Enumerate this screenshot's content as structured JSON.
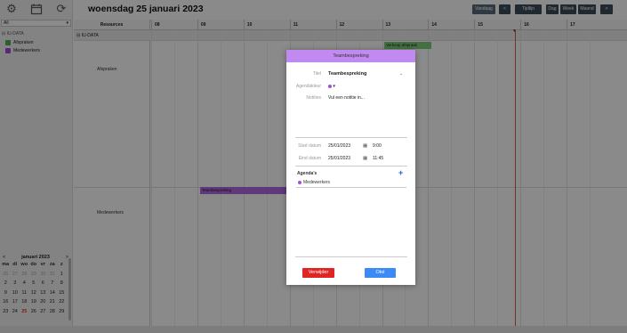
{
  "sidebar": {
    "scope_select": "All",
    "group_label": "IU-DATA",
    "calendars": [
      {
        "label": "Afspraken",
        "color": "#4caf50"
      },
      {
        "label": "Medewerkers",
        "color": "#a64dd6"
      }
    ],
    "mini_calendar": {
      "title": "januari 2023",
      "prev": "<",
      "next": ">",
      "weekdays": [
        "ma",
        "di",
        "wo",
        "do",
        "vr",
        "za",
        "z"
      ],
      "weeks": [
        [
          "26",
          "27",
          "28",
          "29",
          "30",
          "31",
          "1"
        ],
        [
          "2",
          "3",
          "4",
          "5",
          "6",
          "7",
          "8"
        ],
        [
          "9",
          "10",
          "11",
          "12",
          "13",
          "14",
          "15"
        ],
        [
          "16",
          "17",
          "18",
          "19",
          "20",
          "21",
          "22"
        ],
        [
          "23",
          "24",
          "25",
          "26",
          "27",
          "28",
          "29"
        ]
      ]
    }
  },
  "toolbar": {
    "date_title": "woensdag 25 januari 2023",
    "today": "Vandaag",
    "prev": "<",
    "timeline": "Tijdlijn",
    "day": "Dag",
    "week": "Week",
    "month": "Maand",
    "next": ">"
  },
  "timeline": {
    "resources_header": "Resources",
    "hours": [
      "08",
      "09",
      "10",
      "11",
      "12",
      "13",
      "14",
      "15",
      "16",
      "17"
    ],
    "group_row": "IU-DATA",
    "resources": [
      "Afspraken",
      "Medewerkers"
    ],
    "events": [
      {
        "label": "Verkoop afspraak",
        "color": "#7bd07b"
      },
      {
        "label": "Teambespreking",
        "color": "#b06ae0"
      }
    ]
  },
  "modal": {
    "header": "Teambespreking",
    "title_label": "Titel",
    "title_value": "Teambespreking",
    "calendar_label": "Agendakleur",
    "calendar_dot_color": "#a64dd6",
    "notes_label": "Notities",
    "notes_placeholder": "Vul een notitie in...",
    "start_label": "Start datum",
    "start_date": "25/01/2023",
    "start_time": "9:00",
    "end_label": "Eind datum",
    "end_date": "25/01/2023",
    "end_time": "11:45",
    "agendas_title": "Agenda's",
    "agendas": [
      "Medewerkers"
    ],
    "delete_button": "Verwijder",
    "ok_button": "Oké"
  }
}
